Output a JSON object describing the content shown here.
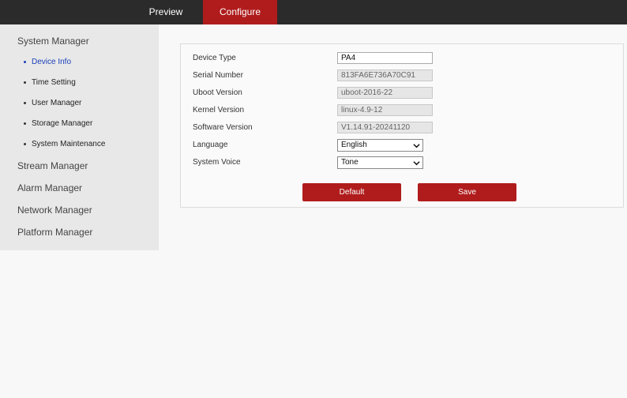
{
  "nav": {
    "tabs": [
      {
        "label": "Preview",
        "active": false
      },
      {
        "label": "Configure",
        "active": true
      }
    ],
    "active_color": "#b01c1c"
  },
  "sidebar": {
    "sections": [
      {
        "label": "System Manager",
        "expanded": true
      },
      {
        "label": "Stream Manager"
      },
      {
        "label": "Alarm Manager"
      },
      {
        "label": "Network Manager"
      },
      {
        "label": "Platform Manager"
      }
    ],
    "system_items": [
      {
        "label": "Device Info",
        "active": true
      },
      {
        "label": "Time Setting"
      },
      {
        "label": "User Manager"
      },
      {
        "label": "Storage Manager"
      },
      {
        "label": "System Maintenance"
      }
    ],
    "active_color": "#1a3fb8"
  },
  "form": {
    "device_type": {
      "label": "Device Type",
      "value": "PA4"
    },
    "serial_number": {
      "label": "Serial Number",
      "value": "813FA6E736A70C91"
    },
    "uboot_version": {
      "label": "Uboot Version",
      "value": "uboot-2016-22"
    },
    "kernel_version": {
      "label": "Kernel Version",
      "value": "linux-4.9-12"
    },
    "software_version": {
      "label": "Software Version",
      "value": "V1.14.91-20241120"
    },
    "language": {
      "label": "Language",
      "value": "English"
    },
    "system_voice": {
      "label": "System Voice",
      "value": "Tone"
    }
  },
  "buttons": {
    "default_label": "Default",
    "save_label": "Save"
  }
}
